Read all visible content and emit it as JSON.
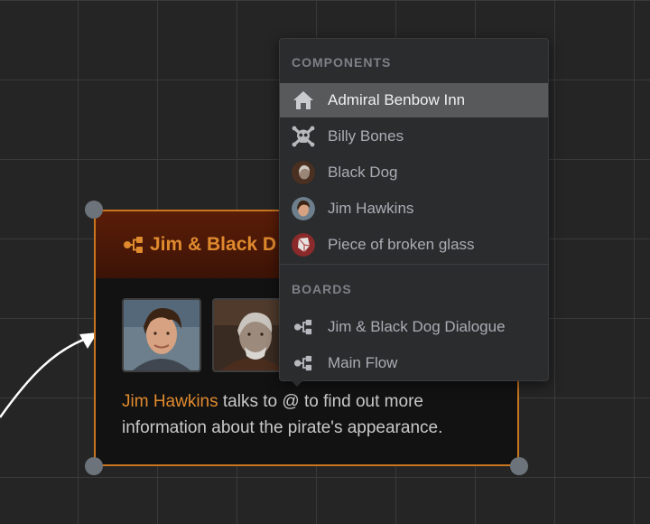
{
  "node": {
    "title": "Jim & Black D",
    "text_mention": "Jim Hawkins",
    "text_rest": " talks to @ to find out more information about the pirate's appearance.",
    "border_color": "#c9761f",
    "accent_color": "#e08a2e",
    "icon": "flow-icon",
    "avatars": [
      "jim-hawkins-portrait",
      "black-dog-portrait"
    ]
  },
  "menu": {
    "components_title": "COMPONENTS",
    "boards_title": "BOARDS",
    "components": [
      {
        "label": "Admiral Benbow Inn",
        "icon": "house-icon",
        "active": true
      },
      {
        "label": "Billy Bones",
        "icon": "skull-crossbones-icon",
        "active": false
      },
      {
        "label": "Black Dog",
        "icon": "black-dog-avatar",
        "active": false
      },
      {
        "label": "Jim Hawkins",
        "icon": "jim-hawkins-avatar",
        "active": false
      },
      {
        "label": "Piece of broken glass",
        "icon": "broken-glass-avatar",
        "active": false
      }
    ],
    "boards": [
      {
        "label": "Jim & Black Dog Dialogue",
        "icon": "flow-icon"
      },
      {
        "label": "Main Flow",
        "icon": "flow-icon"
      }
    ]
  }
}
